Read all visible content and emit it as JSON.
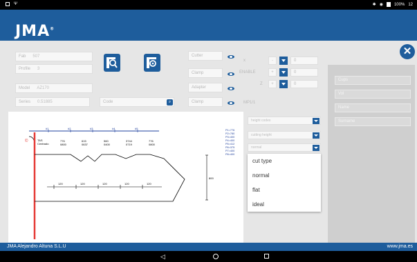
{
  "statusbar": {
    "time": "12",
    "battery": "100%"
  },
  "app": {
    "logo": "JMA",
    "logo_mark": "®"
  },
  "form": {
    "fab": {
      "label": "Fab",
      "value": "507"
    },
    "profile": {
      "label": "Profile",
      "value": "3"
    },
    "model": {
      "label": "Model",
      "value": "AZ170"
    },
    "series": {
      "label": "Series",
      "value": "0.51885"
    },
    "code": {
      "placeholder": "Code"
    },
    "cutter": {
      "label": "Cutter"
    },
    "clamp": {
      "label": "Clamp"
    },
    "adapter": {
      "label": "Adapter"
    },
    "clamp2": {
      "label": "Clamp"
    },
    "right_labels": {
      "x": "x",
      "enable": "ENABLE",
      "z": "Z"
    },
    "mp": "MP1/1",
    "steppers": [
      {
        "value": "0"
      },
      {
        "value": "0"
      },
      {
        "value": "0"
      }
    ]
  },
  "side_panel": {
    "inputs": [
      "Cups",
      "Vol",
      "Name",
      "Surname"
    ]
  },
  "selects": {
    "height": "height codes",
    "cutting": "cutting height",
    "normal": "normal"
  },
  "dropdown_options": [
    "cut type",
    "normal",
    "flat",
    "ideal"
  ],
  "chart_data": {
    "type": "diagram",
    "positions": [
      "#1",
      "#2",
      "#3",
      "#4",
      "#5"
    ],
    "cut_labels": [
      "TAS",
      "Centrado"
    ],
    "depth_codes": [
      "776",
      "615",
      "560",
      "3744",
      "776"
    ],
    "depth_values": [
      "0800",
      "0637",
      "0400",
      "0719",
      "0800"
    ],
    "spacings": [
      "120",
      "120",
      "120",
      "120",
      "120"
    ],
    "ruler": "800",
    "params": [
      "P1=776",
      "P2=780",
      "P3=400",
      "P4=400",
      "P5=412",
      "P6=375",
      "P7=400",
      "P8=400"
    ]
  },
  "footer": {
    "company": "JMA Alejandro Altuna S.L.U",
    "website": "www.jma.es"
  },
  "colors": {
    "brand": "#1e5d9c",
    "red": "#e53935"
  },
  "icons": {
    "key_search": "key-search-icon",
    "key_view": "key-view-icon",
    "close": "close-icon"
  }
}
